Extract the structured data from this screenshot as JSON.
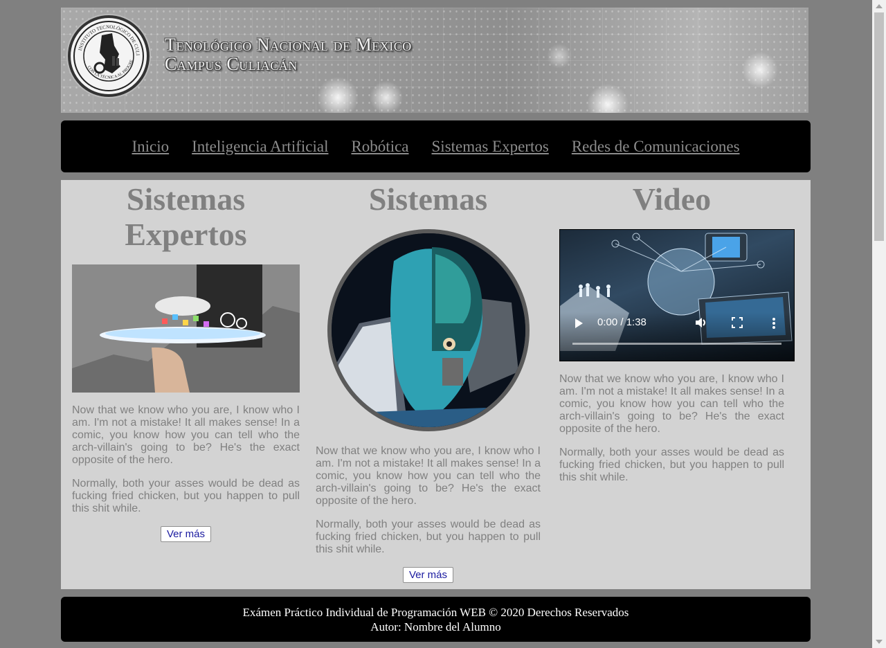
{
  "header": {
    "title_line1": "Tenológico Nacional de Mexico",
    "title_line2": "Campus Culiacán",
    "seal_text": "Instituto Tecnológico de Culiacán — Con la Técnica al Progreso"
  },
  "nav": {
    "items": [
      {
        "label": "Inicio"
      },
      {
        "label": "Inteligencia Artificial"
      },
      {
        "label": "Robótica"
      },
      {
        "label": "Sistemas Expertos"
      },
      {
        "label": "Redes de Comunicaciones"
      }
    ]
  },
  "columns": [
    {
      "title": "Sistemas Expertos",
      "paragraph1": "Now that we know who you are, I know who I am. I'm not a mistake! It all makes sense! In a comic, you know how you can tell who the arch-villain's going to be? He's the exact opposite of the hero.",
      "paragraph2": "Normally, both your asses would be dead as fucking fried chicken, but you happen to pull this shit while.",
      "button_label": "Ver más"
    },
    {
      "title": "Sistemas",
      "paragraph1": "Now that we know who you are, I know who I am. I'm not a mistake! It all makes sense! In a comic, you know how you can tell who the arch-villain's going to be? He's the exact opposite of the hero.",
      "paragraph2": "Normally, both your asses would be dead as fucking fried chicken, but you happen to pull this shit while.",
      "button_label": "Ver más"
    },
    {
      "title": "Video",
      "video_time": "0:00 / 1:38",
      "paragraph1": "Now that we know who you are, I know who I am. I'm not a mistake! It all makes sense! In a comic, you know how you can tell who the arch-villain's going to be? He's the exact opposite of the hero.",
      "paragraph2": "Normally, both your asses would be dead as fucking fried chicken, but you happen to pull this shit while."
    }
  ],
  "footer": {
    "line1": "Exámen Práctico Individual de Programación WEB © 2020 Derechos Reservados",
    "line2": "Autor: Nombre del Alumno"
  },
  "colors": {
    "page_bg": "#808080",
    "content_bg": "#d3d3d3",
    "nav_bg": "#000000",
    "text_gray": "#808080",
    "button_text": "#1a1aa0"
  }
}
